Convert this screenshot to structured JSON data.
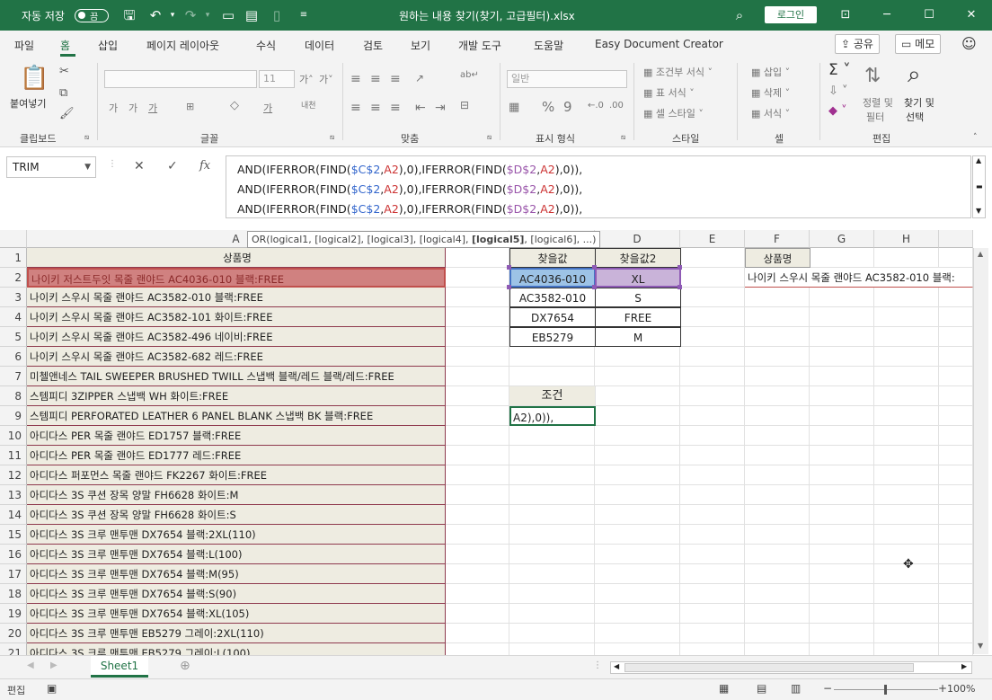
{
  "titlebar": {
    "autosave_label": "자동 저장",
    "autosave_state": "끔",
    "file_title": "원하는 내용 찾기(찾기, 고급필터).xlsx",
    "login_label": "로그인"
  },
  "menu": {
    "items": [
      "파일",
      "홈",
      "삽입",
      "페이지 레이아웃",
      "수식",
      "데이터",
      "검토",
      "보기",
      "개발 도구",
      "도움말",
      "Easy Document Creator"
    ],
    "active_index": 1,
    "share_label": "공유",
    "memo_label": "메모"
  },
  "ribbon": {
    "paste_label": "붙여넣기",
    "font_name": "",
    "font_size": "11",
    "number_format": "일반",
    "cond_format": "조건부 서식",
    "table_format": "표 서식",
    "cell_style": "셀 스타일",
    "insert": "삽입",
    "delete": "삭제",
    "format": "서식",
    "sort_filter": "정렬 및",
    "sort_filter2": "필터",
    "find_select": "찾기 및",
    "find_select2": "선택",
    "groups": [
      "클립보드",
      "글꼴",
      "맞춤",
      "표시 형식",
      "스타일",
      "셀",
      "편집"
    ]
  },
  "formula_bar": {
    "name_box": "TRIM",
    "fx": "fx",
    "tooltip_prefix": "OR(logical1, [logical2], [logical3], [logical4], ",
    "tooltip_bold": "[logical5]",
    "tooltip_suffix": ", [logical6], ...)",
    "lines": [
      {
        "p1": "AND(IFERROR(FIND(",
        "c": "$C$2",
        "p2": ",",
        "a": "A2",
        "p3": "),0),IFERROR(FIND(",
        "d": "$D$2",
        "p4": ",",
        "a2": "A2",
        "p5": "),0)),"
      },
      {
        "p1": "AND(IFERROR(FIND(",
        "c": "$C$2",
        "p2": ",",
        "a": "A2",
        "p3": "),0),IFERROR(FIND(",
        "d": "$D$2",
        "p4": ",",
        "a2": "A2",
        "p5": "),0)),"
      },
      {
        "p1": "AND(IFERROR(FIND(",
        "c": "$C$2",
        "p2": ",",
        "a": "A2",
        "p3": "),0),IFERROR(FIND(",
        "d": "$D$2",
        "p4": ",",
        "a2": "A2",
        "p5": "),0)),"
      }
    ]
  },
  "grid": {
    "columns": [
      "A",
      "B",
      "C",
      "D",
      "E",
      "F",
      "G",
      "H"
    ],
    "rows": [
      "1",
      "2",
      "3",
      "4",
      "5",
      "6",
      "7",
      "8",
      "9",
      "10",
      "11",
      "12",
      "13",
      "14",
      "15",
      "16",
      "17",
      "18",
      "19",
      "20",
      "21"
    ],
    "colA": [
      "상품명",
      "나이키 저스트두잇 목줄 랜야드 AC4036-010 블랙:FREE",
      "나이키 스우시 목줄 랜야드 AC3582-010 블랙:FREE",
      "나이키 스우시 목줄 랜야드 AC3582-101 화이트:FREE",
      "나이키 스우시 목줄 랜야드 AC3582-496 네이비:FREE",
      "나이키 스우시 목줄 랜야드 AC3582-682 레드:FREE",
      "미첼앤네스 TAIL SWEEPER BRUSHED TWILL 스냅백 블랙/레드 블랙/레드:FREE",
      "스템피디 3ZIPPER 스냅백 WH 화이트:FREE",
      "스템피디 PERFORATED LEATHER 6 PANEL BLANK 스냅백 BK 블랙:FREE",
      "아디다스 PER 목줄 랜야드 ED1757 블랙:FREE",
      "아디다스 PER 목줄 랜야드 ED1777 레드:FREE",
      "아디다스 퍼포먼스 목줄 랜야드 FK2267 화이트:FREE",
      "아디다스 3S 쿠션 장목 양말 FH6628 화이트:M",
      "아디다스 3S 쿠션 장목 양말 FH6628 화이트:S",
      "아디다스 3S 크루 맨투맨 DX7654 블랙:2XL(110)",
      "아디다스 3S 크루 맨투맨 DX7654 블랙:L(100)",
      "아디다스 3S 크루 맨투맨 DX7654 블랙:M(95)",
      "아디다스 3S 크루 맨투맨 DX7654 블랙:S(90)",
      "아디다스 3S 크루 맨투맨 DX7654 블랙:XL(105)",
      "아디다스 3S 크루 맨투맨 EB5279 그레이:2XL(110)",
      "아디다스 3S 크루 맨투맨 EB5279 그레이:L(100)"
    ],
    "colC": [
      "찾을값",
      "AC4036-010",
      "AC3582-010",
      "DX7654",
      "EB5279"
    ],
    "colD": [
      "찾을값2",
      "XL",
      "S",
      "FREE",
      "M"
    ],
    "criteria_header": "조건",
    "criteria_edit": "A2),0)),",
    "colF_header": "상품명",
    "colF_row2": "나이키 스우시 목줄 랜야드 AC3582-010 블랙:"
  },
  "sheets": [
    "Sheet1"
  ],
  "status": {
    "mode": "편집",
    "zoom": "100%"
  },
  "colors": {
    "accent": "#217346",
    "selected_row": "#d08180",
    "colA_fill": "#eeece1",
    "c_fill": "#9dc3e6",
    "d_fill": "#c9b3d9"
  }
}
